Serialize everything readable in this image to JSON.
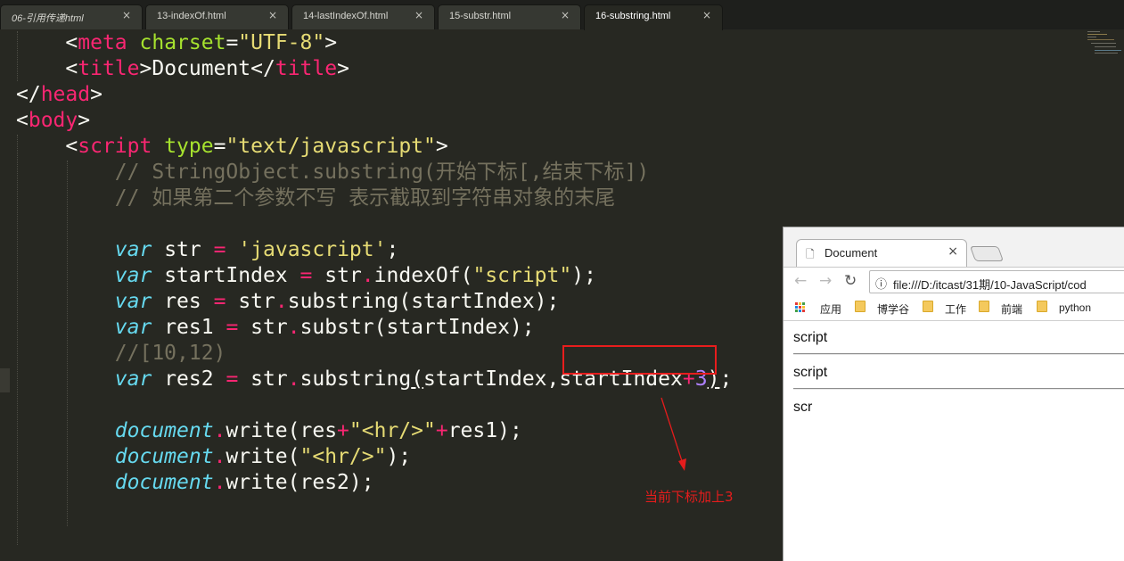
{
  "tabs": [
    {
      "label": "06-引用传递html",
      "close": "×"
    },
    {
      "label": "13-indexOf.html",
      "close": "×"
    },
    {
      "label": "14-lastIndexOf.html",
      "close": "×"
    },
    {
      "label": "15-substr.html",
      "close": "×"
    },
    {
      "label": "16-substring.html",
      "close": "×"
    }
  ],
  "code": {
    "l1": {
      "p1": "<",
      "tag": "meta",
      "attr": "charset",
      "eq": "=",
      "val": "\"UTF-8\"",
      "p2": ">"
    },
    "l2": {
      "p1": "<",
      "tag1": "title",
      "p2": ">",
      "text": "Document",
      "p3": "</",
      "tag2": "title",
      "p4": ">"
    },
    "l3": {
      "p1": "</",
      "tag": "head",
      "p2": ">"
    },
    "l4": {
      "p1": "<",
      "tag": "body",
      "p2": ">"
    },
    "l5": {
      "p1": "<",
      "tag": "script",
      "attr": "type",
      "eq": "=",
      "val": "\"text/javascript\"",
      "p2": ">"
    },
    "l6": "// StringObject.substring(开始下标[,结束下标])",
    "l7": "// 如果第二个参数不写 表示截取到字符串对象的末尾",
    "l8": {
      "kw": "var",
      "name": "str",
      "op": "=",
      "str": "'javascript'",
      "end": ";"
    },
    "l9": {
      "kw": "var",
      "name": "startIndex",
      "op": "=",
      "obj": "str",
      "dot": ".",
      "call": "indexOf(",
      "str": "\"script\"",
      "end": ");"
    },
    "l10": {
      "kw": "var",
      "name": "res",
      "op": "=",
      "obj": "str",
      "dot": ".",
      "call": "substring(startIndex);"
    },
    "l11": {
      "kw": "var",
      "name": "res1",
      "op": "=",
      "obj": "str",
      "dot": ".",
      "call": "substr(startIndex);"
    },
    "l12": "//[10,12)",
    "l13": {
      "kw": "var",
      "name": "res2",
      "op": "=",
      "obj": "str",
      "dot": ".",
      "call": "substring",
      "paren": "(",
      "arg1": "startIndex,",
      "arg2": "startIndex",
      "plus": "+",
      "num": "3",
      "close": ")",
      "end": ";"
    },
    "l14": {
      "obj": "document",
      "dot": ".",
      "call": "write(res",
      "plus1": "+",
      "str": "\"<hr/>\"",
      "plus2": "+",
      "rest": "res1);"
    },
    "l15": {
      "obj": "document",
      "dot": ".",
      "call": "write(",
      "str": "\"<hr/>\"",
      "end": ");"
    },
    "l16": {
      "obj": "document",
      "dot": ".",
      "call": "write(res2);"
    }
  },
  "annotation": {
    "text": "当前下标加上3",
    "color": "#e51c1c"
  },
  "browser": {
    "tab_title": "Document",
    "tab_close": "×",
    "address": "file:///D:/itcast/31期/10-JavaScript/cod",
    "bookmarks": [
      "应用",
      "博学谷",
      "工作",
      "前端",
      "python"
    ],
    "output": [
      "script",
      "script",
      "scr"
    ]
  },
  "colors": {
    "tag": "#f92672",
    "attr": "#a6e22e",
    "string": "#e6db74",
    "comment": "#75715e",
    "keyword": "#66d9ef",
    "number": "#ae81ff",
    "background": "#272822"
  },
  "icons": {
    "tab_close": "close-icon",
    "browser_back": "arrow-left-icon",
    "browser_forward": "arrow-right-icon",
    "browser_reload": "reload-icon",
    "address_info": "info-icon",
    "page": "page-icon",
    "apps": "apps-grid-icon",
    "bookmark": "folder-icon"
  }
}
